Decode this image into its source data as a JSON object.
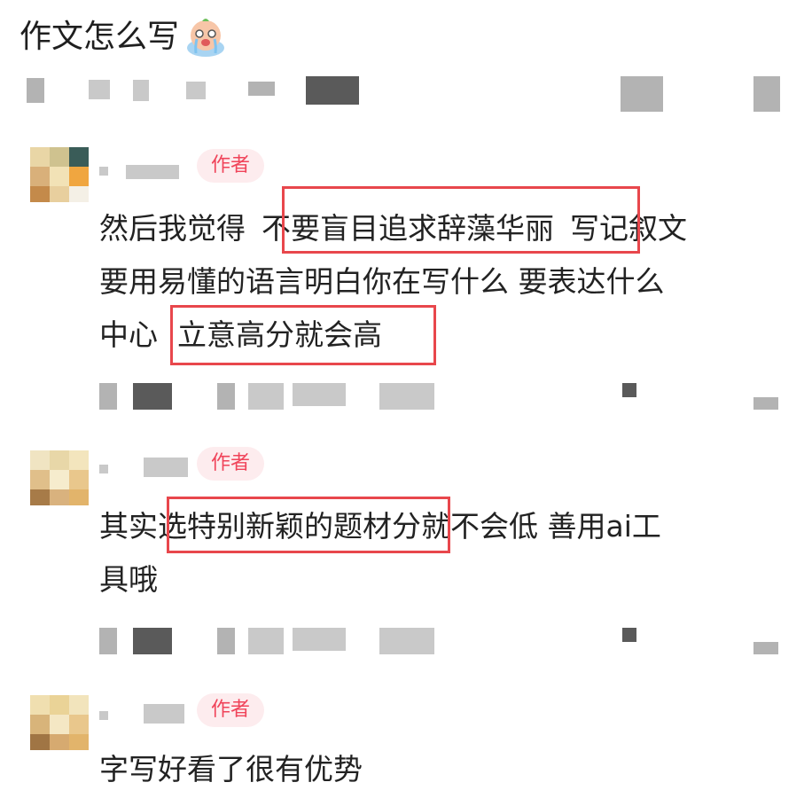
{
  "post": {
    "title": "作文怎么写",
    "emoji": "crying-face-emoji"
  },
  "comments": [
    {
      "badge": "作者",
      "lines": [
        [
          "然后我觉得",
          "不要盲目追求辞藻华丽",
          "写记叙文"
        ],
        [
          "要用易懂的语言明白你在写什么 要表达什么"
        ],
        [
          "中心",
          "立意高分就会高"
        ]
      ]
    },
    {
      "badge": "作者",
      "lines": [
        [
          "其实",
          "选特别新颖的题材",
          "分就不会低 善用ai工"
        ],
        [
          "具哦"
        ]
      ]
    },
    {
      "badge": "作者",
      "lines": [
        [
          "字写好看了很有优势"
        ]
      ]
    }
  ],
  "colors": {
    "highlight": "#e8474c",
    "badge_text": "#f0445a",
    "badge_bg": "#fdecee"
  }
}
